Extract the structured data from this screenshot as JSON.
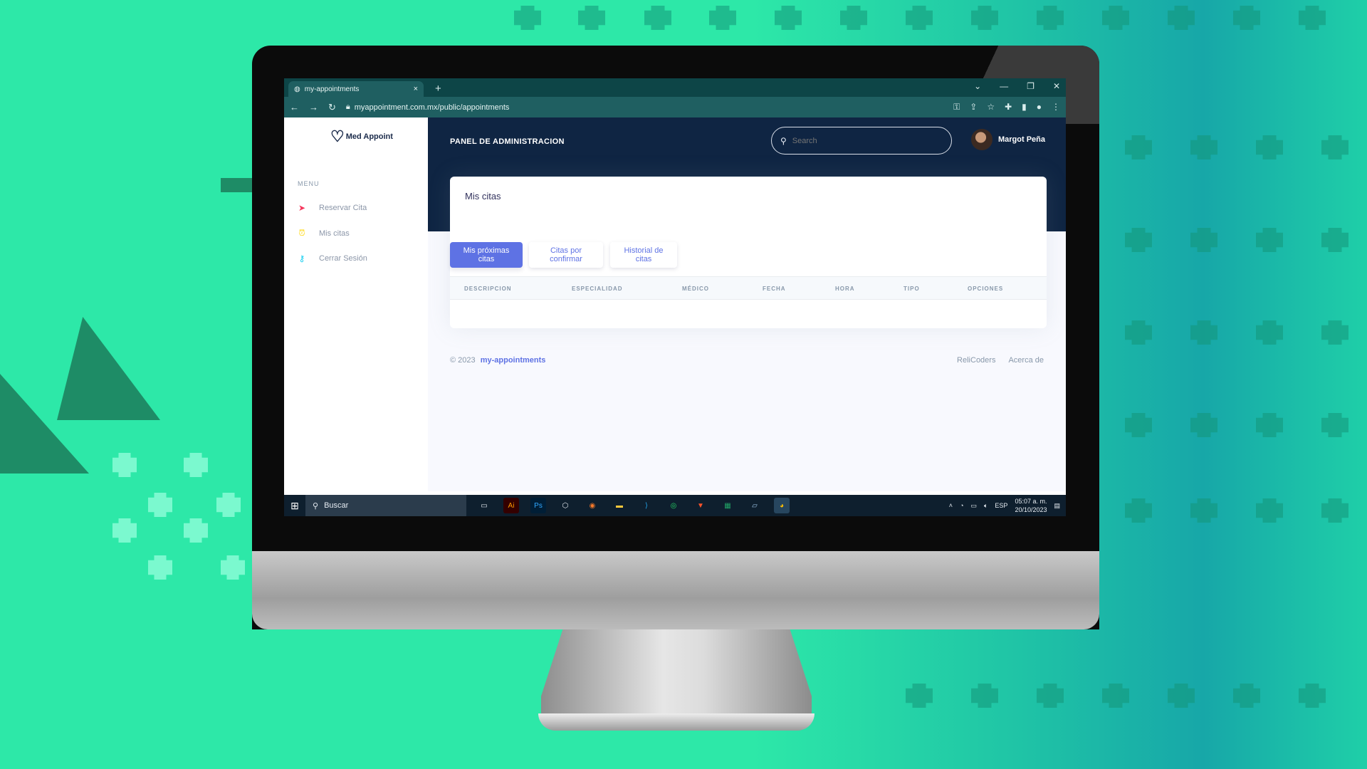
{
  "browser": {
    "tab_title": "my-appointments",
    "tab_close": "×",
    "new_tab": "+",
    "url": "myappointment.com.mx/public/appointments",
    "window_controls": [
      "⌄",
      "—",
      "❐",
      "✕"
    ]
  },
  "sidebar": {
    "menu_heading": "MENU",
    "logo_text": "Med Appoint",
    "items": [
      {
        "label": "Reservar Cita",
        "icon": "paper-plane-icon",
        "color": "#f5365c"
      },
      {
        "label": "Mis citas",
        "icon": "clock-icon",
        "color": "#ffd600"
      },
      {
        "label": "Cerrar Sesión",
        "icon": "key-icon",
        "color": "#11cdef"
      }
    ]
  },
  "header": {
    "title": "PANEL DE ADMINISTRACION",
    "search_placeholder": "Search",
    "user_name": "Margot Peña"
  },
  "card": {
    "title": "Mis citas",
    "tabs": [
      {
        "label": "Mis próximas citas",
        "active": true
      },
      {
        "label": "Citas por confirmar",
        "active": false
      },
      {
        "label": "Historial de citas",
        "active": false
      }
    ],
    "columns": [
      "DESCRIPCION",
      "ESPECIALIDAD",
      "MÉDICO",
      "FECHA",
      "HORA",
      "TIPO",
      "OPCIONES"
    ]
  },
  "footer": {
    "copyright": "© 2023",
    "brand": "my-appointments",
    "links": [
      "ReliCoders",
      "Acerca de"
    ]
  },
  "taskbar": {
    "search_label": "Buscar",
    "language": "ESP",
    "time": "05:07 a. m.",
    "date": "20/10/2023",
    "apps": [
      "task-view-icon",
      "illustrator-icon",
      "photoshop-icon",
      "unity-icon",
      "blender-icon",
      "file-explorer-icon",
      "vscode-icon",
      "whatsapp-icon",
      "brave-icon",
      "excel-icon",
      "notes-icon",
      "chrome-icon"
    ]
  },
  "colors": {
    "primary": "#5e72e4",
    "header_bg": "#0f2543",
    "browser_chrome": "#1f5f61",
    "background_green": "#2de8a8"
  }
}
